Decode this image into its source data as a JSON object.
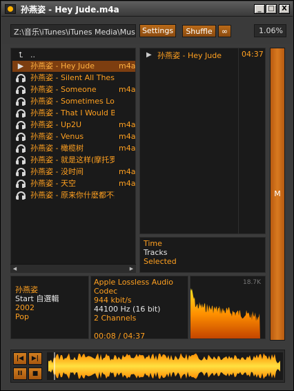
{
  "window": {
    "title": "孙燕姿 - Hey Jude.m4a"
  },
  "window_controls": {
    "minimize": "_",
    "maximize": "□",
    "close": "X"
  },
  "toolbar": {
    "path": "Z:\\音乐\\iTunes\\iTunes Media\\Music\\",
    "settings_label": "Settings",
    "shuffle_label": "Shuffle",
    "repeat_label": "∞",
    "percent": "1.06%"
  },
  "playlist": {
    "parent_label": "..",
    "items": [
      {
        "name": "孙燕姿 - Hey Jude",
        "format": "m4a",
        "active": true
      },
      {
        "name": "孙燕姿 - Silent All These Years",
        "format": ""
      },
      {
        "name": "孙燕姿 - Someone",
        "format": "m4a"
      },
      {
        "name": "孙燕姿 - Sometimes Love Just",
        "format": ""
      },
      {
        "name": "孙燕姿 - That I Would Be Gooc",
        "format": ""
      },
      {
        "name": "孙燕姿 - Up2U",
        "format": "m4a"
      },
      {
        "name": "孙燕姿 - Venus",
        "format": "m4a"
      },
      {
        "name": "孙燕姿 - 橄榄树",
        "format": "m4a"
      },
      {
        "name": "孙燕姿 - 就是这样(摩托罗拉I",
        "format": ""
      },
      {
        "name": "孙燕姿 - 没时间",
        "format": "m4a"
      },
      {
        "name": "孙燕姿 - 天空",
        "format": "m4a"
      },
      {
        "name": "孙燕姿 - 原来你什麽都不要.r",
        "format": ""
      }
    ]
  },
  "queue": {
    "track": "孙燕姿 - Hey Jude",
    "time": "04:37"
  },
  "stats": {
    "time_label": "Time",
    "tracks_label": "Tracks",
    "selected_label": "Selected"
  },
  "info": {
    "artist": "孙燕姿",
    "album": "Start 自選輯",
    "year": "2002",
    "genre": "Pop",
    "codec": "Apple Lossless Audio Codec",
    "bitrate": "944 kbit/s",
    "samplerate": "44100 Hz (16 bit)",
    "channels": "2 Channels",
    "position": "00:08 / 04:37",
    "spectrum_label": "18.7K"
  },
  "volume": {
    "label": "M"
  },
  "transport": {
    "prev": "|◀",
    "next": "▶|",
    "pause": "II",
    "stop": "■"
  },
  "colors": {
    "accent": "#ffa020",
    "active_row": "#7d3e10",
    "panel": "#1a1a1a",
    "frame": "#3b3b3b"
  }
}
